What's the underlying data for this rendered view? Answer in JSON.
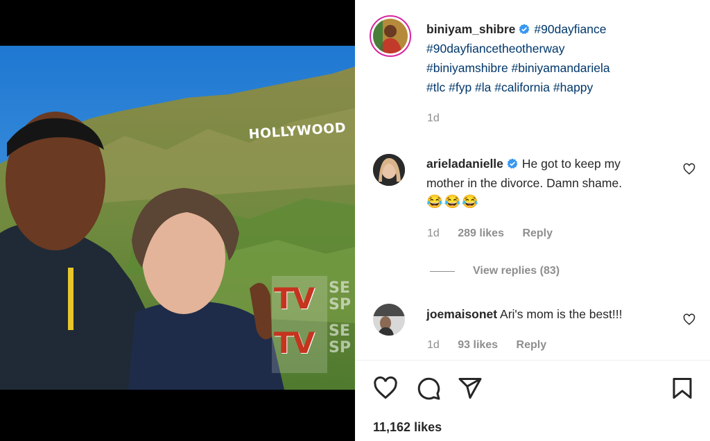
{
  "post": {
    "author": "biniyam_shibre",
    "caption_tags": [
      "#90dayfiance",
      "#90dayfiancetheotherway",
      "#biniyamshibre #biniyamandariela",
      "#tlc #fyp #la #california #happy"
    ],
    "time": "1d",
    "likes": "11,162 likes"
  },
  "image": {
    "sign_text": "HOLLYWOOD",
    "watermark": "TV",
    "watermark_side": [
      "SE",
      "SP"
    ]
  },
  "comments": [
    {
      "user": "arieladanielle",
      "verified": true,
      "text_line1": "He got to keep my",
      "text_line2": "mother in the divorce. Damn shame.",
      "emoji": "😂😂😂",
      "time": "1d",
      "likes": "289 likes",
      "reply": "Reply",
      "view_replies": "View replies (83)"
    },
    {
      "user": "joemaisonet",
      "verified": false,
      "text": "Ari's mom is the best!!!",
      "time": "1d",
      "likes": "93 likes",
      "reply": "Reply"
    }
  ],
  "actions": [
    "heart-icon",
    "comment-icon",
    "share-icon",
    "bookmark-icon"
  ],
  "colors": {
    "verified": "#3897f0",
    "hashtag": "#00376b",
    "meta": "#8e8e8e"
  }
}
